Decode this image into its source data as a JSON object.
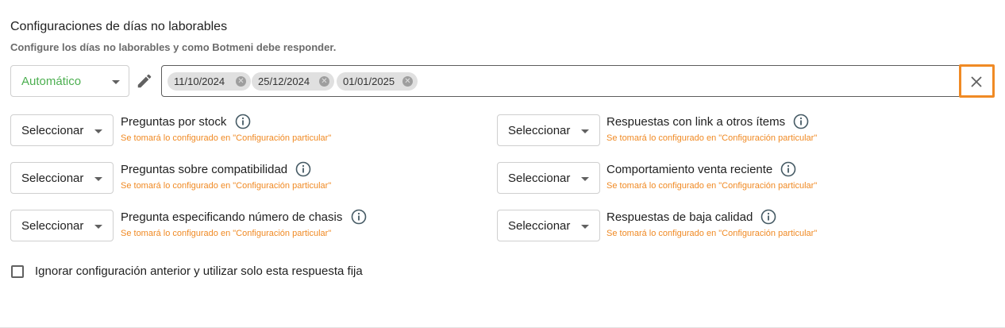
{
  "section": {
    "title": "Configuraciones de días no laborables",
    "subtitle": "Configure los días no laborables y como Botmeni debe responder."
  },
  "mode_select": {
    "value": "Automático"
  },
  "dates": [
    "11/10/2024",
    "25/12/2024",
    "01/01/2025"
  ],
  "clear_button": {
    "symbol": "✕"
  },
  "options": [
    {
      "select_value": "Seleccionar",
      "label": "Preguntas por stock",
      "note": "Se tomará lo configurado en \"Configuración particular\""
    },
    {
      "select_value": "Seleccionar",
      "label": "Respuestas con link a otros ítems",
      "note": "Se tomará lo configurado en \"Configuración particular\""
    },
    {
      "select_value": "Seleccionar",
      "label": "Preguntas sobre compatibilidad",
      "note": "Se tomará lo configurado en \"Configuración particular\""
    },
    {
      "select_value": "Seleccionar",
      "label": "Comportamiento venta reciente",
      "note": "Se tomará lo configurado en \"Configuración particular\""
    },
    {
      "select_value": "Seleccionar",
      "label": "Pregunta especificando número de chasis",
      "note": "Se tomará lo configurado en \"Configuración particular\""
    },
    {
      "select_value": "Seleccionar",
      "label": "Respuestas de baja calidad",
      "note": "Se tomará lo configurado en \"Configuración particular\""
    }
  ],
  "ignore_checkbox": {
    "label": "Ignorar configuración anterior y utilizar solo esta respuesta fija",
    "checked": false
  },
  "colors": {
    "mode_value": "#4caf50",
    "note": "#f08a24",
    "highlight_border": "#f08a24"
  },
  "icons": {
    "edit": "pencil-icon",
    "info": "info-icon",
    "chip_remove": "cancel-circle-icon",
    "clear": "close-icon",
    "dropdown": "caret-down-icon"
  }
}
